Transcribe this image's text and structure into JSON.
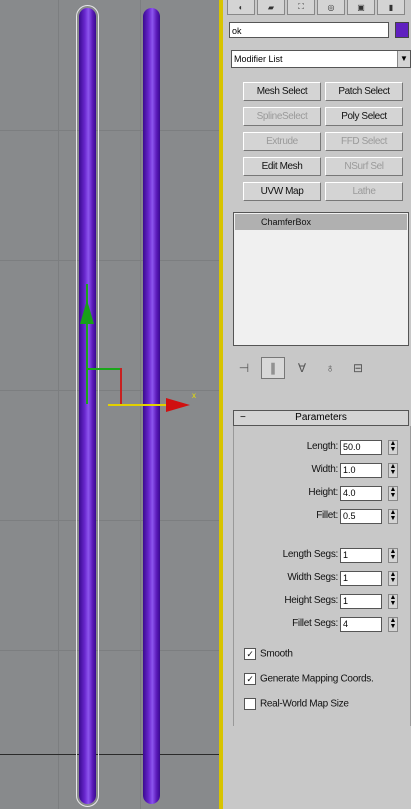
{
  "command_panel": {
    "tabs": [
      "create-icon",
      "modify-icon",
      "hierarchy-icon",
      "motion-icon",
      "display-icon",
      "utilities-icon"
    ],
    "object_name": "ok",
    "object_color": "#6020c0",
    "modifier_list": "Modifier List",
    "modifier_buttons": [
      "Mesh Select",
      "Patch Select",
      "SplineSelect",
      "Poly Select",
      "Extrude",
      "FFD Select",
      "Edit Mesh",
      "NSurf Sel",
      "UVW Map",
      "Lathe"
    ],
    "modifier_stack": [
      "ChamferBox"
    ],
    "stack_tools": [
      "pin-stack-icon",
      "show-end-result-icon",
      "make-unique-icon",
      "remove-modifier-icon",
      "configure-sets-icon"
    ]
  },
  "parameters": {
    "header": "Parameters",
    "collapse_glyph": "−",
    "fields": [
      {
        "label": "Length:",
        "value": "50.0"
      },
      {
        "label": "Width:",
        "value": "1.0"
      },
      {
        "label": "Height:",
        "value": "4.0"
      },
      {
        "label": "Fillet:",
        "value": "0.5"
      },
      {
        "label": "Length Segs:",
        "value": "1"
      },
      {
        "label": "Width Segs:",
        "value": "1"
      },
      {
        "label": "Height Segs:",
        "value": "1"
      },
      {
        "label": "Fillet Segs:",
        "value": "4"
      }
    ],
    "checkboxes": [
      {
        "label": "Smooth",
        "checked": true
      },
      {
        "label": "Generate Mapping Coords.",
        "checked": true
      },
      {
        "label": "Real-World Map Size",
        "checked": false
      }
    ]
  }
}
